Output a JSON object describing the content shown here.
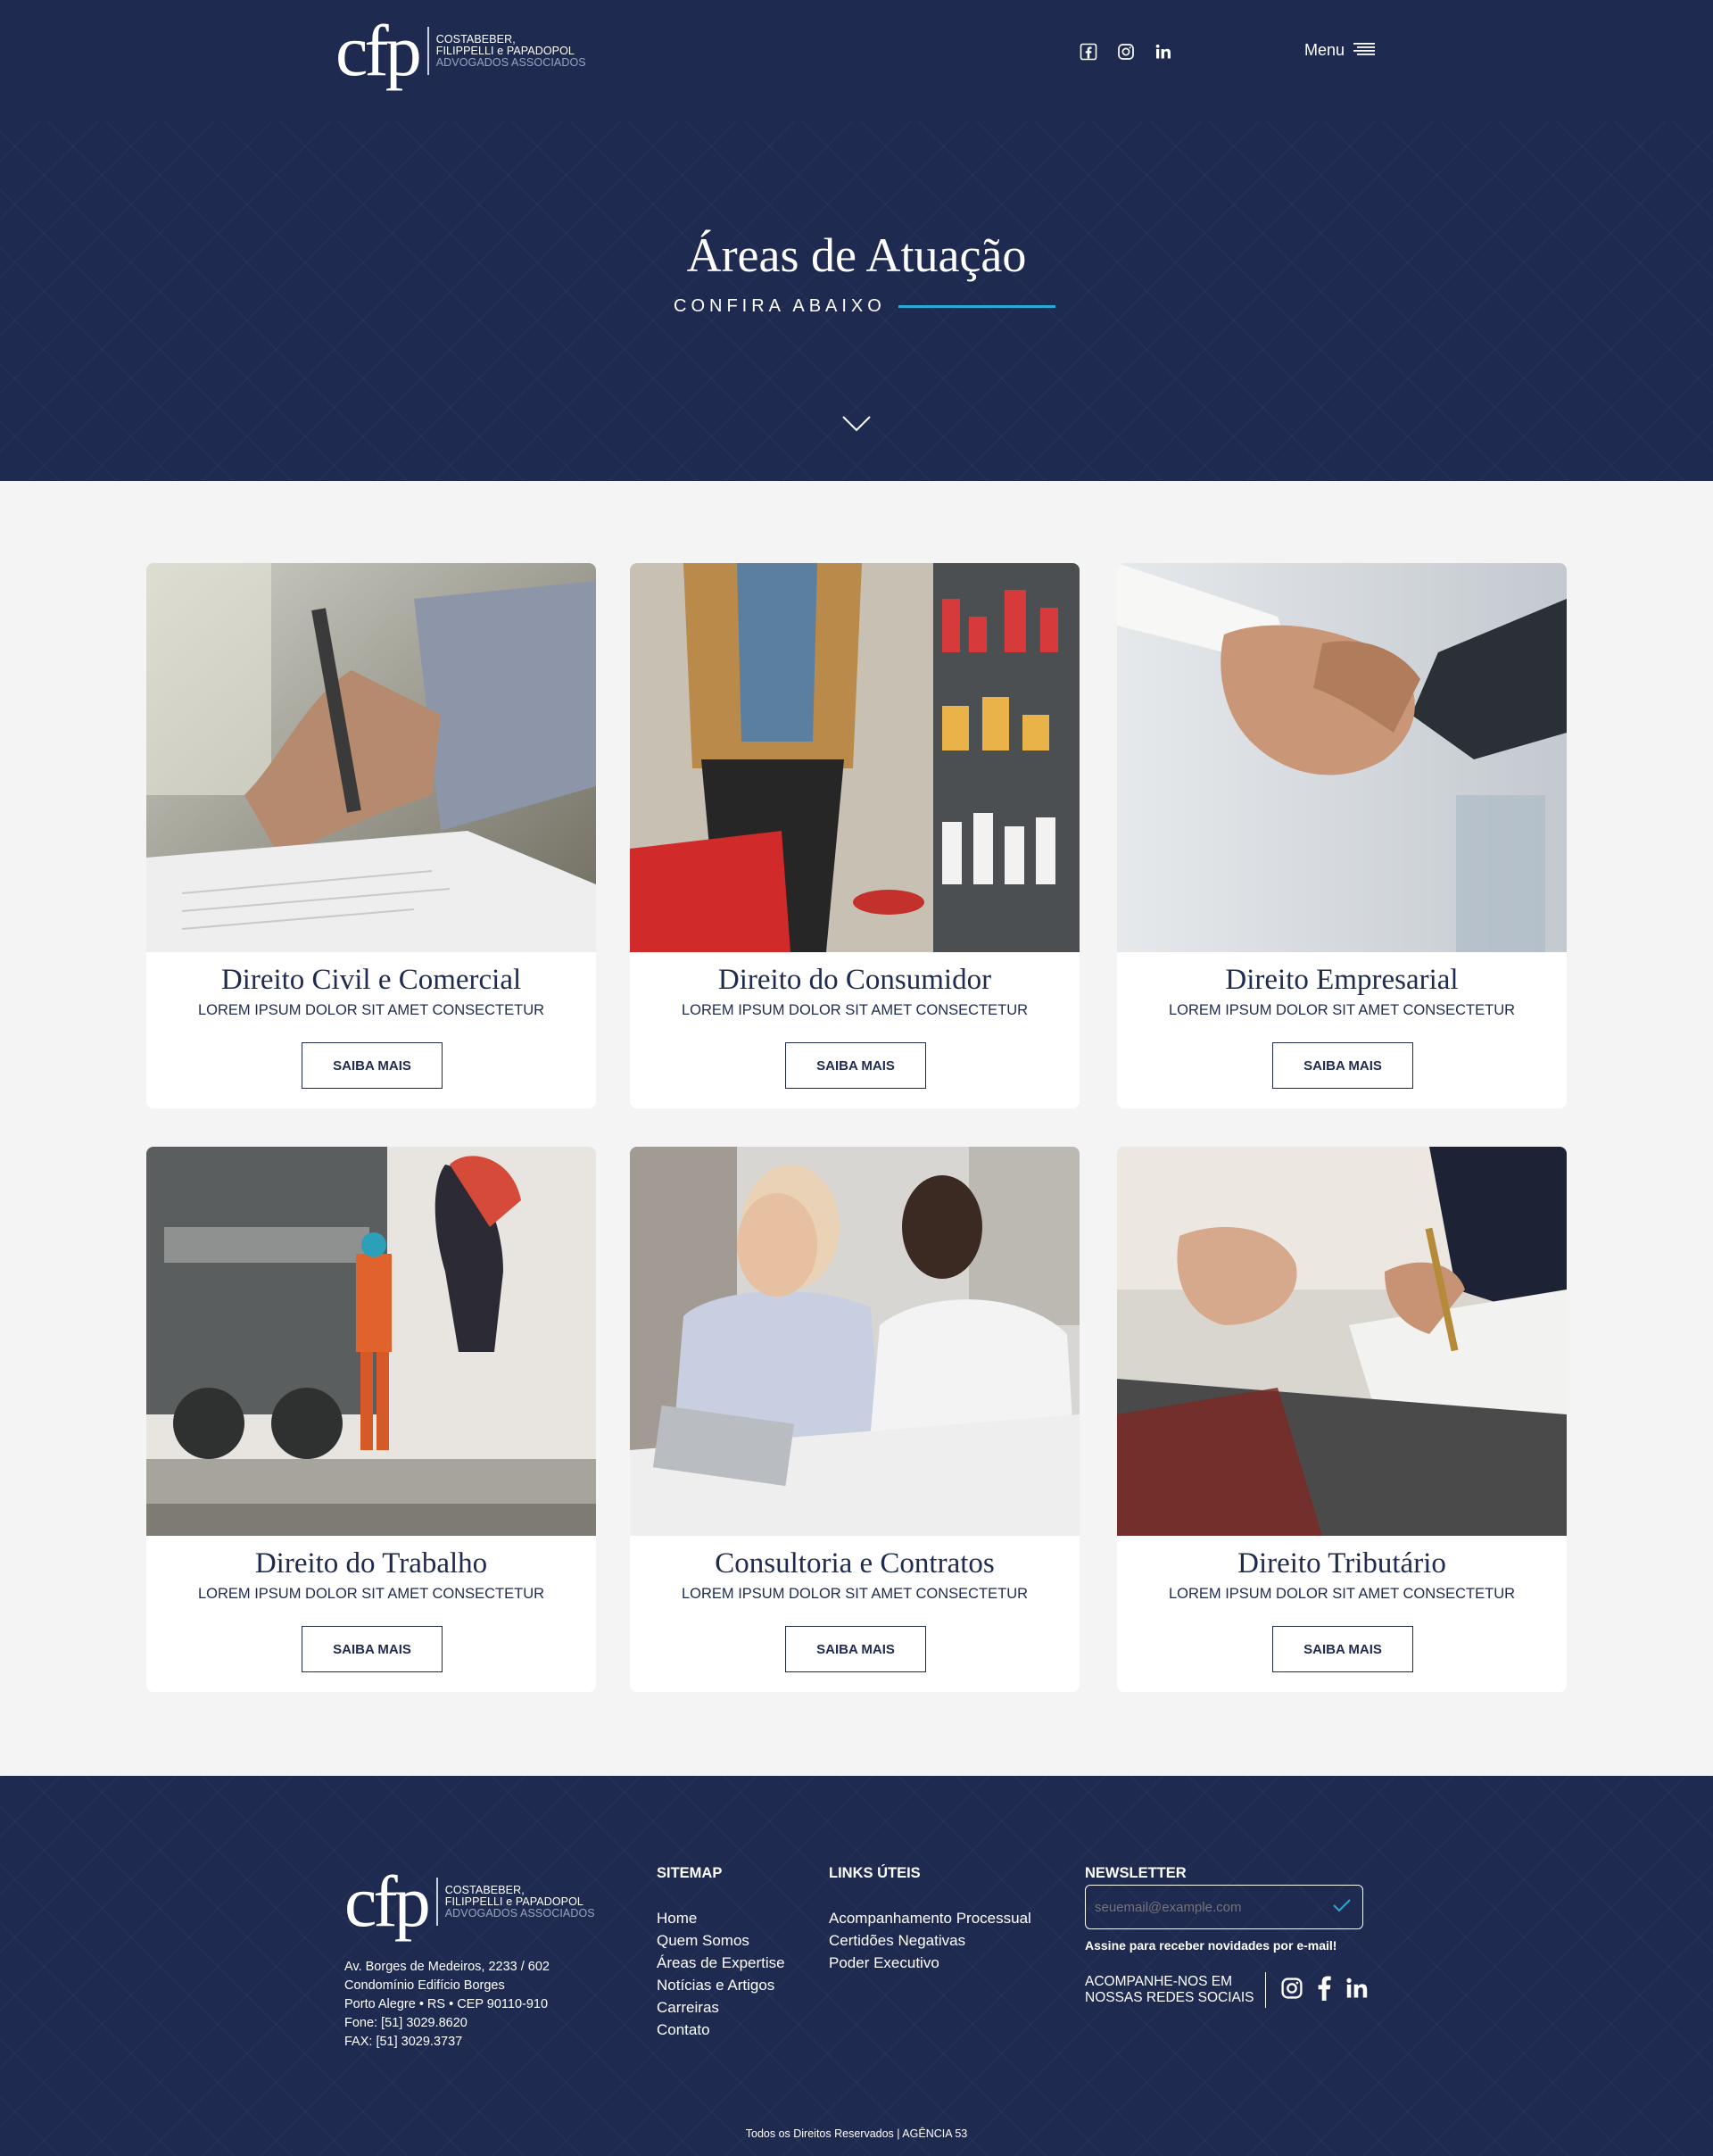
{
  "header": {
    "logo": {
      "monogram": "cfp",
      "line1": "COSTABEBER,",
      "line2": "FILIPPELLI e PAPADOPOL",
      "line3": "ADVOGADOS ASSOCIADOS"
    },
    "social_icons": [
      "facebook-icon",
      "instagram-icon",
      "linkedin-icon"
    ],
    "menu_label": "Menu"
  },
  "hero": {
    "title": "Áreas de Atuação",
    "subtitle": "CONFIRA ABAIXO",
    "accent_color": "#2aa8d8"
  },
  "cards": [
    {
      "title": "Direito Civil e Comercial",
      "description": "LOREM IPSUM DOLOR SIT AMET CONSECTETUR",
      "button": "SAIBA MAIS"
    },
    {
      "title": "Direito do Consumidor",
      "description": "LOREM IPSUM DOLOR SIT AMET CONSECTETUR",
      "button": "SAIBA MAIS"
    },
    {
      "title": "Direito Empresarial",
      "description": "LOREM IPSUM DOLOR SIT AMET CONSECTETUR",
      "button": "SAIBA MAIS"
    },
    {
      "title": "Direito do Trabalho",
      "description": "LOREM IPSUM DOLOR SIT AMET CONSECTETUR",
      "button": "SAIBA MAIS"
    },
    {
      "title": "Consultoria e Contratos",
      "description": "LOREM IPSUM DOLOR SIT AMET CONSECTETUR",
      "button": "SAIBA MAIS"
    },
    {
      "title": "Direito Tributário",
      "description": "LOREM IPSUM DOLOR SIT AMET CONSECTETUR",
      "button": "SAIBA MAIS"
    }
  ],
  "footer": {
    "logo": {
      "monogram": "cfp",
      "line1": "COSTABEBER,",
      "line2": "FILIPPELLI e PAPADOPOL",
      "line3": "ADVOGADOS ASSOCIADOS"
    },
    "address": [
      "Av. Borges de Medeiros, 2233 / 602",
      "Condomínio Edifício Borges",
      "Porto Alegre • RS • CEP 90110-910",
      "Fone: [51] 3029.8620",
      "FAX: [51] 3029.3737"
    ],
    "sitemap": {
      "heading": "SITEMAP",
      "links": [
        "Home",
        "Quem Somos",
        "Áreas de Expertise",
        "Notícias e Artigos",
        "Carreiras",
        "Contato"
      ]
    },
    "links_uteis": {
      "heading": "LINKS ÚTEIS",
      "links": [
        "Acompanhamento Processual",
        "Certidões Negativas",
        "Poder Executivo"
      ]
    },
    "newsletter": {
      "heading": "NEWSLETTER",
      "placeholder": "seuemail@example.com",
      "note": "Assine para receber novidades por e-mail!",
      "follow_line1": "ACOMPANHE-NOS EM",
      "follow_line2": "NOSSAS REDES SOCIAIS"
    },
    "copyright": "Todos os Direitos Reservados | AGÊNCIA 53"
  },
  "colors": {
    "navy": "#1e2a50",
    "background": "#f4f4f4",
    "accent": "#2aa8d8"
  }
}
